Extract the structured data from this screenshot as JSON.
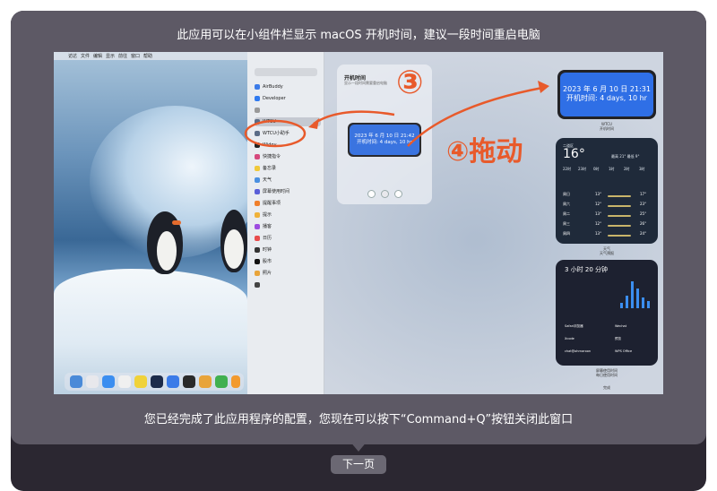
{
  "window": {
    "heading": "此应用可以在小组件栏显示 macOS 开机时间，建议一段时间重启电脑",
    "footer": "您已经完成了此应用程序的配置，您现在可以按下“Command+Q”按钮关闭此窗口",
    "next_button": "下一页"
  },
  "screenshot": {
    "menubar": [
      "",
      "访达",
      "文件",
      "编辑",
      "显示",
      "前往",
      "窗口",
      "帮助"
    ],
    "sidebar": {
      "items": [
        {
          "label": "AirBuddy",
          "color": "#3b7be8"
        },
        {
          "label": "Developer",
          "color": "#2f7af0"
        },
        {
          "label": "",
          "color": "#999999"
        },
        {
          "label": "WTCU",
          "color": "#5b6c86"
        },
        {
          "label": "WTCU小助手",
          "color": "#5b6c86"
        },
        {
          "label": "Widgy",
          "color": "#222222"
        },
        {
          "label": "快捷指令",
          "color": "#d6497d"
        },
        {
          "label": "备忘录",
          "color": "#f0c93a"
        },
        {
          "label": "天气",
          "color": "#4b90e0"
        },
        {
          "label": "屏幕使用时间",
          "color": "#5a5fd8"
        },
        {
          "label": "提醒事项",
          "color": "#f07f2b"
        },
        {
          "label": "提示",
          "color": "#f0b23a"
        },
        {
          "label": "播客",
          "color": "#9d4ce0"
        },
        {
          "label": "日历",
          "color": "#e84c4c"
        },
        {
          "label": "时钟",
          "color": "#333333"
        },
        {
          "label": "股市",
          "color": "#111111"
        },
        {
          "label": "照片",
          "color": "#e8a43a"
        },
        {
          "label": "",
          "color": "#444444"
        }
      ]
    },
    "card": {
      "title": "开机时间",
      "subtitle": "显示一段时间需要重启电脑",
      "widget_line1": "2023 年 6 月 10 日 21:42",
      "widget_line2": "开机时间: 4 days, 10 hr"
    },
    "placed_widget": {
      "line1": "2023 年 6 月 10 日 21:31",
      "line2": "开机时间: 4 days, 10 hr",
      "caption": "WTCU",
      "caption2": "开机时间"
    },
    "weather": {
      "temp": "16°",
      "location": "二道区",
      "summary": "最高 21° 最低 9°",
      "hours": [
        "22时",
        "23时",
        "0时",
        "1时",
        "2时",
        "3时"
      ],
      "days": [
        {
          "day": "周日",
          "low": "13°",
          "high": "17°"
        },
        {
          "day": "周六",
          "low": "12°",
          "high": "23°"
        },
        {
          "day": "周二",
          "low": "13°",
          "high": "25°"
        },
        {
          "day": "周三",
          "low": "12°",
          "high": "26°"
        },
        {
          "day": "周四",
          "low": "13°",
          "high": "24°"
        }
      ],
      "caption": "天气",
      "caption2": "天气预报"
    },
    "screen_time": {
      "title": "3 小时 20 分钟",
      "apps": [
        "Safari浏览器",
        "Wechat",
        "Xcode",
        "预览",
        "chat@ohrnaroon",
        "WPS Office"
      ],
      "caption": "屏幕使用时间",
      "caption2": "每日使用时间"
    },
    "done_label": "完成"
  },
  "annotations": {
    "step3": "③",
    "step4": "④拖动"
  }
}
